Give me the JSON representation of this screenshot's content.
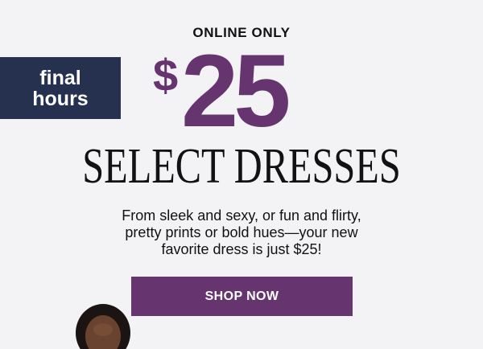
{
  "promo": {
    "eyebrow": "ONLINE ONLY",
    "badge_line1": "final",
    "badge_line2": "hours",
    "price_currency": "$",
    "price_amount": "25",
    "headline": "SELECT DRESSES",
    "body_line1": "From sleek and sexy, or fun and flirty,",
    "body_line2": "pretty prints or bold hues—your new",
    "body_line3": "favorite dress is just $25!",
    "cta_label": "SHOP NOW"
  },
  "colors": {
    "background": "#f3f3f5",
    "badge": "#25314f",
    "accent_purple": "#66356f",
    "text": "#111111"
  }
}
